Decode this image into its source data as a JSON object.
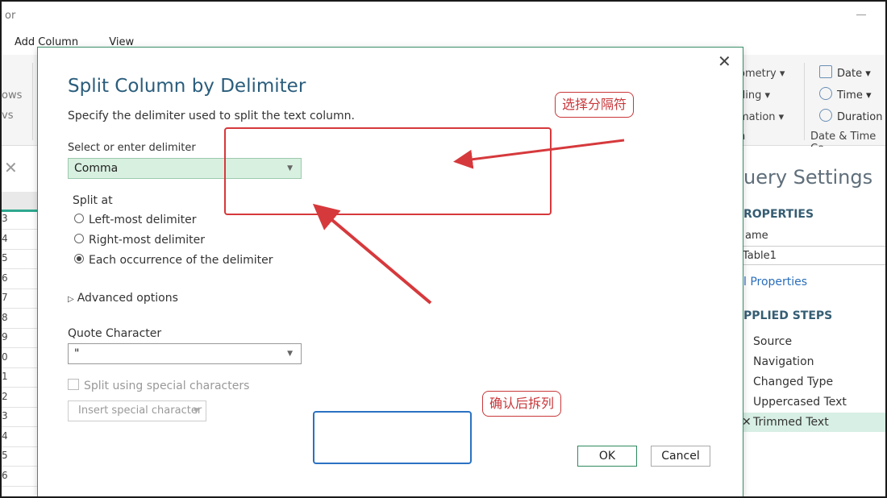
{
  "app": {
    "title_fragment": "or"
  },
  "ribbon": {
    "tabs": [
      "Add Column",
      "View"
    ],
    "left_items": [
      "ows",
      "vs"
    ],
    "mid_items": [
      "ometry ▾",
      "ding ▾",
      "mation ▾"
    ],
    "mid_group_label": "n",
    "right_items": [
      {
        "label": "Date ▾",
        "icon": "calendar-icon"
      },
      {
        "label": "Time ▾",
        "icon": "clock-icon"
      },
      {
        "label": "Duration",
        "icon": "stopwatch-icon"
      }
    ],
    "right_group_label": "Date & Time Co"
  },
  "grid": {
    "row_numbers": [
      "3",
      "4",
      "5",
      "6",
      "7",
      "8",
      "9",
      "0",
      "1",
      "2",
      "3",
      "4",
      "5",
      "6"
    ]
  },
  "query_settings": {
    "title": "uery Settings",
    "properties_header": "ROPERTIES",
    "name_label": "ame",
    "name_value": "Table1",
    "all_properties_link": "l Properties",
    "applied_steps_header": "PPLIED STEPS",
    "steps": [
      "Source",
      "Navigation",
      "Changed Type",
      "Uppercased Text",
      "Trimmed Text"
    ],
    "active_step_index": 4
  },
  "dialog": {
    "title": "Split Column by Delimiter",
    "description": "Specify the delimiter used to split the text column.",
    "delimiter_label": "Select or enter delimiter",
    "delimiter_value": "Comma",
    "split_at_label": "Split at",
    "split_options": [
      "Left-most delimiter",
      "Right-most delimiter",
      "Each occurrence of the delimiter"
    ],
    "split_selected_index": 2,
    "advanced_options": "Advanced options",
    "quote_label": "Quote Character",
    "quote_value": "\"",
    "special_chars_label": "Split using special characters",
    "insert_special_label": "Insert special character",
    "ok_label": "OK",
    "cancel_label": "Cancel",
    "close_glyph": "✕"
  },
  "annotations": {
    "choose_delimiter": "选择分隔符",
    "confirm_split": "确认后拆列",
    "red_color": "#d6393c",
    "blue_color": "#2a72c2"
  },
  "colors": {
    "dialog_title": "#2a5d7c",
    "select_fill": "#d8f0e0",
    "active_step": "#d7efe4",
    "accent_green": "#2fa88f"
  }
}
